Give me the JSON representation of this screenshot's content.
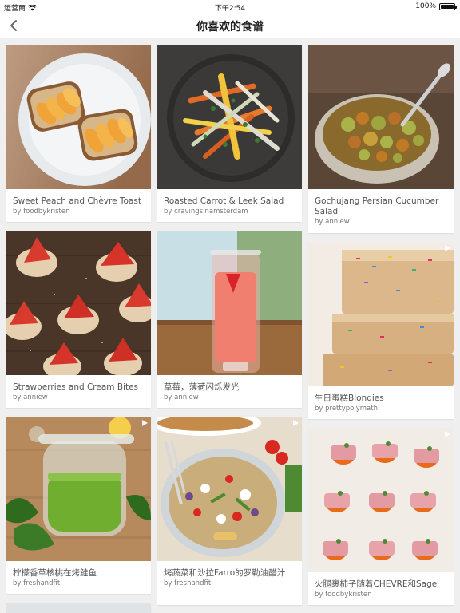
{
  "status": {
    "carrier": "运营商",
    "time": "下午2:54",
    "battery": "100%",
    "battery_level": 1.0
  },
  "nav": {
    "back_icon": "chevron-left-icon",
    "title": "你喜欢的食谱"
  },
  "recipes": [
    {
      "title": "Sweet Peach and Chèvre Toast",
      "author": "by foodbykristen"
    },
    {
      "title": "Roasted Carrot & Leek Salad",
      "author": "by cravingsinamsterdam"
    },
    {
      "title": "Gochujang Persian Cucumber Salad",
      "author": "by anniew"
    },
    {
      "title": "Strawberries and Cream Bites",
      "author": "by anniew"
    },
    {
      "title": "草莓，薄荷闪烁发光",
      "author": "by anniew"
    },
    {
      "title": "生日蛋糕Blondies",
      "author": "by prettypolymath"
    },
    {
      "title": "柠檬香草核桃在烤鲑鱼",
      "author": "by freshandfit"
    },
    {
      "title": "烤蔬菜和沙拉Farro的罗勒油醋汁",
      "author": "by freshandfit"
    },
    {
      "title": "火腿裹柿子随着CHEVRE和Sage",
      "author": "by foodbykristen"
    }
  ]
}
